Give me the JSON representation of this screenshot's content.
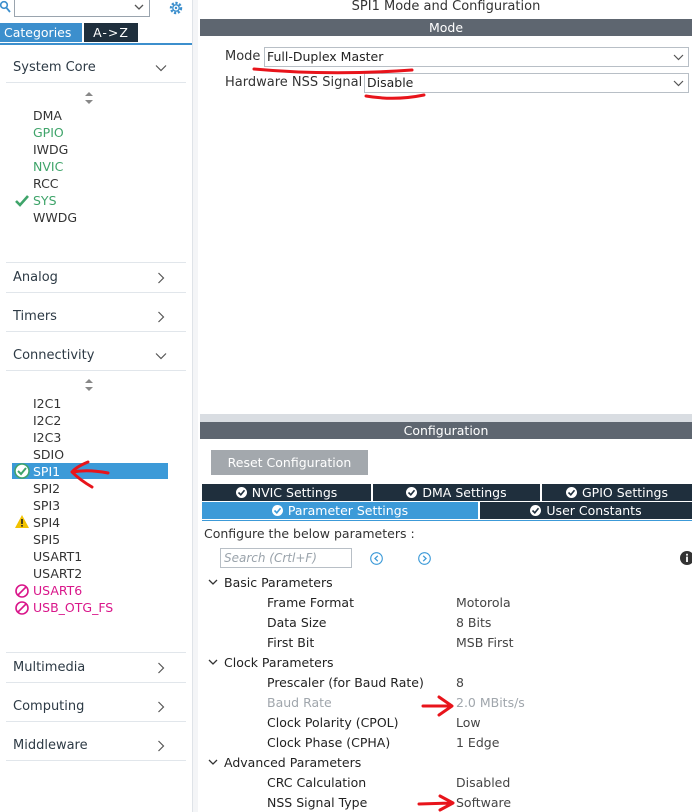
{
  "sidebar": {
    "tabs": {
      "categories": "Categories",
      "az": "A->Z"
    },
    "categories": [
      {
        "label": "System Core",
        "expanded": true
      },
      {
        "label": "Analog",
        "expanded": false
      },
      {
        "label": "Timers",
        "expanded": false
      },
      {
        "label": "Connectivity",
        "expanded": true
      },
      {
        "label": "Multimedia",
        "expanded": false
      },
      {
        "label": "Computing",
        "expanded": false
      },
      {
        "label": "Middleware",
        "expanded": false
      }
    ],
    "system_core_items": [
      "DMA",
      "GPIO",
      "IWDG",
      "NVIC",
      "RCC",
      "SYS",
      "WWDG"
    ],
    "connectivity_items": [
      "I2C1",
      "I2C2",
      "I2C3",
      "SDIO",
      "SPI1",
      "SPI2",
      "SPI3",
      "SPI4",
      "SPI5",
      "USART1",
      "USART2",
      "USART6",
      "USB_OTG_FS"
    ],
    "colors": {
      "enabled": "#3fa46a",
      "conflict": "#d9168a",
      "selected": "#3c9ad8",
      "warning": "#f2c200"
    }
  },
  "window": {
    "title": "SPI1 Mode and Configuration"
  },
  "mode": {
    "header": "Mode",
    "mode_label": "Mode",
    "mode_value": "Full-Duplex Master",
    "nss_label": "Hardware NSS Signal",
    "nss_value": "Disable"
  },
  "config": {
    "header": "Configuration",
    "reset_label": "Reset Configuration",
    "tabs": {
      "nvic": "NVIC Settings",
      "dma": "DMA Settings",
      "gpio": "GPIO Settings",
      "params": "Parameter Settings",
      "user": "User Constants"
    },
    "configure_label": "Configure the below parameters :",
    "search_placeholder": "Search (Crtl+F)",
    "groups": [
      {
        "name": "Basic Parameters",
        "params": [
          {
            "name": "Frame Format",
            "value": "Motorola"
          },
          {
            "name": "Data Size",
            "value": "8 Bits"
          },
          {
            "name": "First Bit",
            "value": "MSB First"
          }
        ]
      },
      {
        "name": "Clock Parameters",
        "params": [
          {
            "name": "Prescaler (for Baud Rate)",
            "value": "8"
          },
          {
            "name": "Baud Rate",
            "value": "2.0 MBits/s"
          },
          {
            "name": "Clock Polarity (CPOL)",
            "value": "Low"
          },
          {
            "name": "Clock Phase (CPHA)",
            "value": "1 Edge"
          }
        ]
      },
      {
        "name": "Advanced Parameters",
        "params": [
          {
            "name": "CRC Calculation",
            "value": "Disabled"
          },
          {
            "name": "NSS Signal Type",
            "value": "Software"
          }
        ]
      }
    ]
  },
  "annotation_color": "#e8141b"
}
